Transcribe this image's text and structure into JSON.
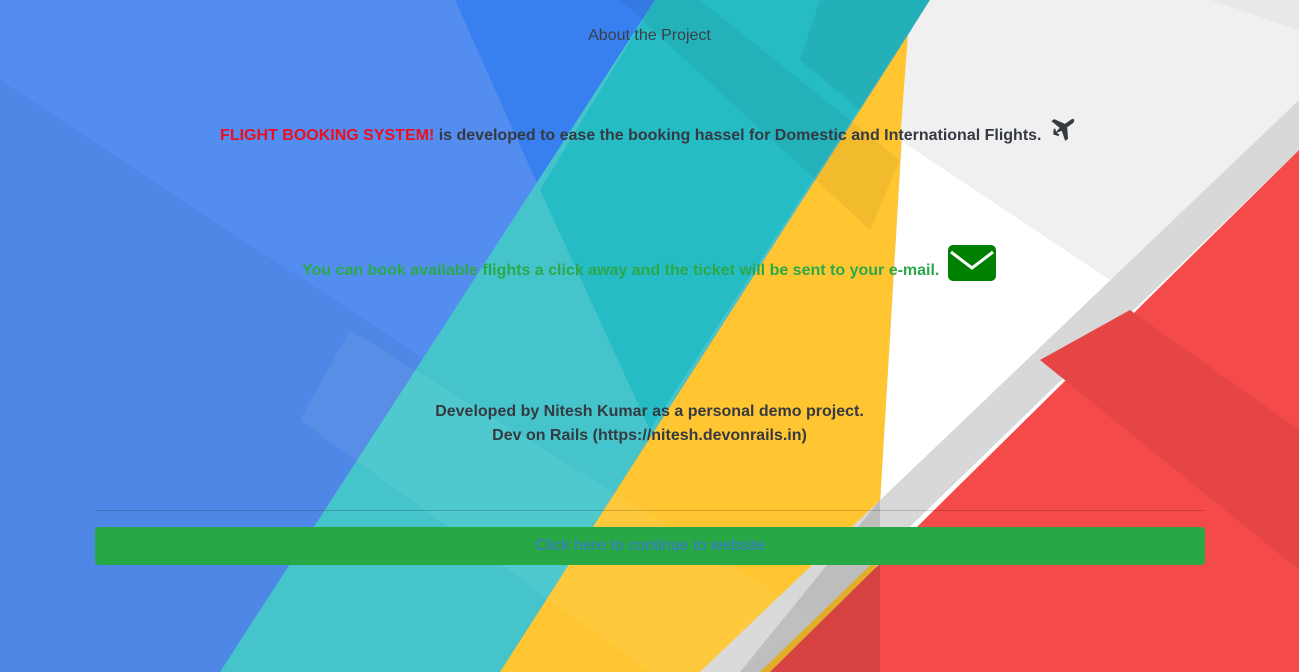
{
  "header": {
    "title": "About the Project"
  },
  "intro": {
    "brand": "FLIGHT BOOKING SYSTEM!",
    "text": " is developed to ease the booking hassel for Domestic and International Flights.",
    "icon": "plane-icon"
  },
  "email_note": {
    "text": "You can book available flights a click away and the ticket will be sent to your e-mail.",
    "icon": "envelope-icon"
  },
  "credits": {
    "line1": "Developed by Nitesh Kumar as a personal demo project.",
    "line2": "Dev on Rails (https://nitesh.devonrails.in)"
  },
  "cta": {
    "label": "Click here to continue to website"
  },
  "colors": {
    "blue": "#548df0",
    "teal": "#26bcc5",
    "yellow": "#ffc631",
    "red": "#f44a4a",
    "white": "#ffffff",
    "brand_red": "#ee0e1e",
    "green": "#28a745",
    "envelope_green": "#008000"
  }
}
